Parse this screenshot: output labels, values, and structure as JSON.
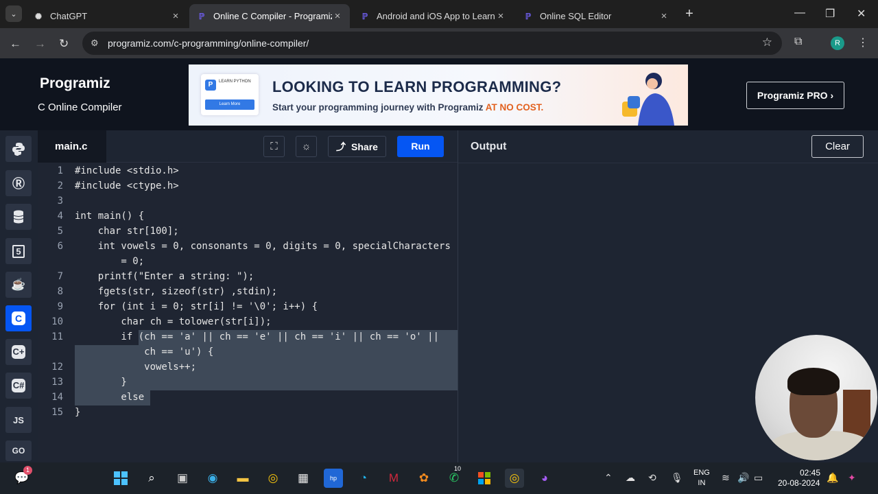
{
  "browser": {
    "tabs": [
      {
        "title": "ChatGPT",
        "icon": "chatgpt-icon"
      },
      {
        "title": "Online C Compiler - Programiz",
        "icon": "programiz-icon"
      },
      {
        "title": "Android and iOS App to Learn Programming",
        "icon": "programiz-icon"
      },
      {
        "title": "Online SQL Editor",
        "icon": "programiz-icon"
      }
    ],
    "url": "programiz.com/c-programming/online-compiler/",
    "profile_initial": "R"
  },
  "header": {
    "logo": "Programiz",
    "subtitle": "C Online Compiler",
    "pro_button": "Programiz PRO ›",
    "banner": {
      "card_title": "LEARN PYTHON",
      "card_button": "Learn More",
      "headline": "LOOKING TO LEARN PROGRAMMING?",
      "subline": "Start your programming journey with Programiz",
      "highlight": "AT NO COST."
    }
  },
  "sidebar": {
    "items": [
      "python-icon",
      "r-icon",
      "sql-icon",
      "html5-icon",
      "java-icon",
      "c-icon",
      "cpp-icon",
      "csharp-icon",
      "js-icon",
      "go-icon"
    ],
    "js_label": "JS",
    "go_label": "GO"
  },
  "editor": {
    "filename": "main.c",
    "share_label": "Share",
    "run_label": "Run",
    "lines": [
      {
        "n": "1",
        "t": "#include <stdio.h>"
      },
      {
        "n": "2",
        "t": "#include <ctype.h>"
      },
      {
        "n": "3",
        "t": ""
      },
      {
        "n": "4",
        "t": "int main() {"
      },
      {
        "n": "5",
        "t": "    char str[100];"
      },
      {
        "n": "6",
        "t": "    int vowels = 0, consonants = 0, digits = 0, specialCharacters"
      },
      {
        "n": "",
        "t": "        = 0;"
      },
      {
        "n": "7",
        "t": "    printf(\"Enter a string: \");"
      },
      {
        "n": "8",
        "t": "    fgets(str, sizeof(str) ,stdin);"
      },
      {
        "n": "9",
        "t": "    for (int i = 0; str[i] != '\\0'; i++) {"
      },
      {
        "n": "10",
        "t": "        char ch = tolower(str[i]);"
      },
      {
        "n": "11",
        "t": "        if (ch == 'a' || ch == 'e' || ch == 'i' || ch == 'o' ||"
      },
      {
        "n": "",
        "t": "            ch == 'u') {"
      },
      {
        "n": "12",
        "t": "            vowels++;"
      },
      {
        "n": "13",
        "t": "        }"
      },
      {
        "n": "14",
        "t": "        else"
      },
      {
        "n": "15",
        "t": "}"
      }
    ]
  },
  "output": {
    "title": "Output",
    "clear_label": "Clear"
  },
  "taskbar": {
    "lang_top": "ENG",
    "lang_bottom": "IN",
    "time": "02:45",
    "date": "20-08-2024",
    "chat_badge": "1",
    "whatsapp_badge": "10"
  },
  "colors": {
    "accent": "#0556f3",
    "editor_bg": "#1f2532",
    "header_bg": "#0f141e"
  }
}
